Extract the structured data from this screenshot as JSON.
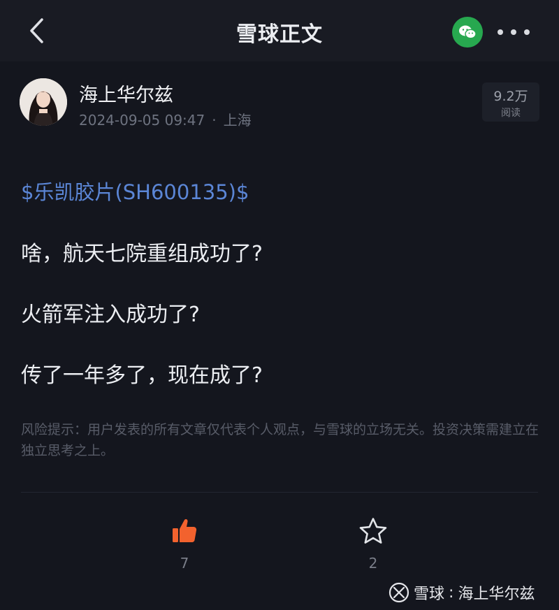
{
  "header": {
    "title": "雪球正文"
  },
  "author": {
    "name": "海上华尔兹",
    "date": "2024-09-05 09:47",
    "separator": "·",
    "location": "上海",
    "views_count": "9.2万",
    "views_label": "阅读"
  },
  "post": {
    "stock_tag": "$乐凯胶片(SH600135)$",
    "paragraphs": [
      "啥，航天七院重组成功了?",
      "火箭军注入成功了?",
      "传了一年多了，现在成了?"
    ],
    "risk_notice": "风险提示：用户发表的所有文章仅代表个人观点，与雪球的立场无关。投资决策需建立在独立思考之上。"
  },
  "actions": {
    "like_count": "7",
    "favorite_count": "2"
  },
  "watermark": {
    "brand": "雪球",
    "separator": ":",
    "author": "海上华尔兹"
  },
  "colors": {
    "background": "#14161e",
    "header_bg": "#191b23",
    "link": "#5b86d6",
    "like": "#f2622e",
    "wechat": "#27a84f"
  },
  "icons": {
    "back": "chevron-left-icon",
    "wechat": "wechat-icon",
    "more": "more-dots-icon",
    "like": "thumbs-up-icon",
    "favorite": "star-icon",
    "watermark_logo": "xueqiu-logo-icon"
  }
}
